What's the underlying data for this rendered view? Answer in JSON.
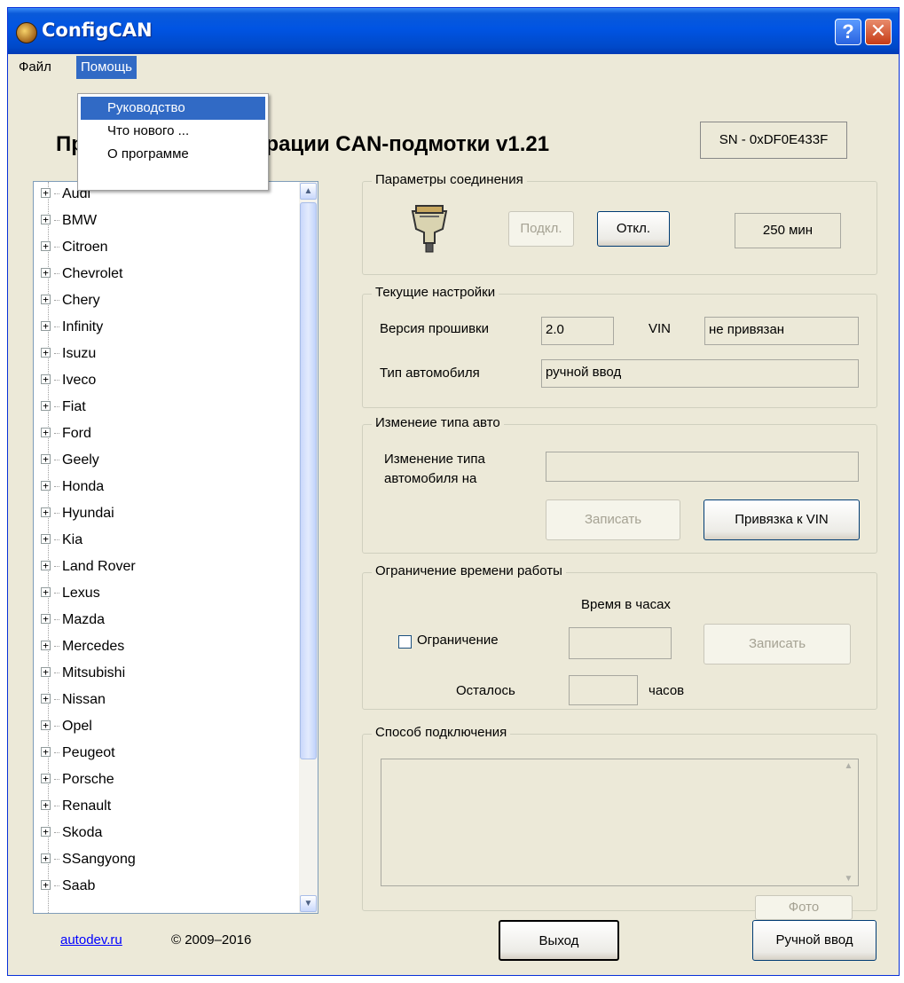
{
  "window": {
    "title": "ConfigCAN"
  },
  "menubar": {
    "file": "Файл",
    "help": "Помощь"
  },
  "help_menu": {
    "items": [
      "Руководство",
      "Что нового ...",
      "О программе"
    ]
  },
  "header": {
    "title_left": "Пр",
    "title_right": "ригурации CAN-подмотки v1.21",
    "serial": "SN - 0xDF0E433F"
  },
  "car_list": {
    "items": [
      "Audi",
      "BMW",
      "Citroen",
      "Chevrolet",
      "Chery",
      "Infinity",
      "Isuzu",
      "Iveco",
      "Fiat",
      "Ford",
      "Geely",
      "Honda",
      "Hyundai",
      "Kia",
      "Land Rover",
      "Lexus",
      "Mazda",
      "Mercedes",
      "Mitsubishi",
      "Nissan",
      "Opel",
      "Peugeot",
      "Porsche",
      "Renault",
      "Skoda",
      "SSangyong",
      "Saab"
    ]
  },
  "connection": {
    "title": "Параметры соединения",
    "connect_label": "Подкл.",
    "disconnect_label": "Откл.",
    "time_value": "250 мин"
  },
  "current_settings": {
    "title": "Текущие настройки",
    "firmware_label": "Версия прошивки",
    "firmware_value": "2.0",
    "vin_label": "VIN",
    "vin_value": "не привязан",
    "car_type_label": "Тип автомобиля",
    "car_type_value": "ручной ввод"
  },
  "change_type": {
    "title": "Изменеие типа авто",
    "label_line1": "Изменение типа",
    "label_line2": "автомобиля на",
    "value": "",
    "write_label": "Записать",
    "bind_vin_label": "Привязка к VIN"
  },
  "time_limit": {
    "title": "Ограничение времени работы",
    "hours_caption": "Время в часах",
    "limit_label": "Ограничение",
    "limit_checked": false,
    "hours_value": "",
    "write_label": "Записать",
    "remaining_label": "Осталось",
    "remaining_value": "",
    "hours_unit": "часов"
  },
  "connection_method": {
    "title": "Способ подключения",
    "text": "",
    "photo_label": "Фото"
  },
  "footer": {
    "link": "autodev.ru",
    "copyright": "© 2009–2016",
    "exit_label": "Выход",
    "manual_label": "Ручной ввод"
  },
  "colors": {
    "window_bg": "#ece9d8",
    "title_blue": "#0054e3",
    "selection": "#316ac5",
    "link": "#0000ff"
  }
}
